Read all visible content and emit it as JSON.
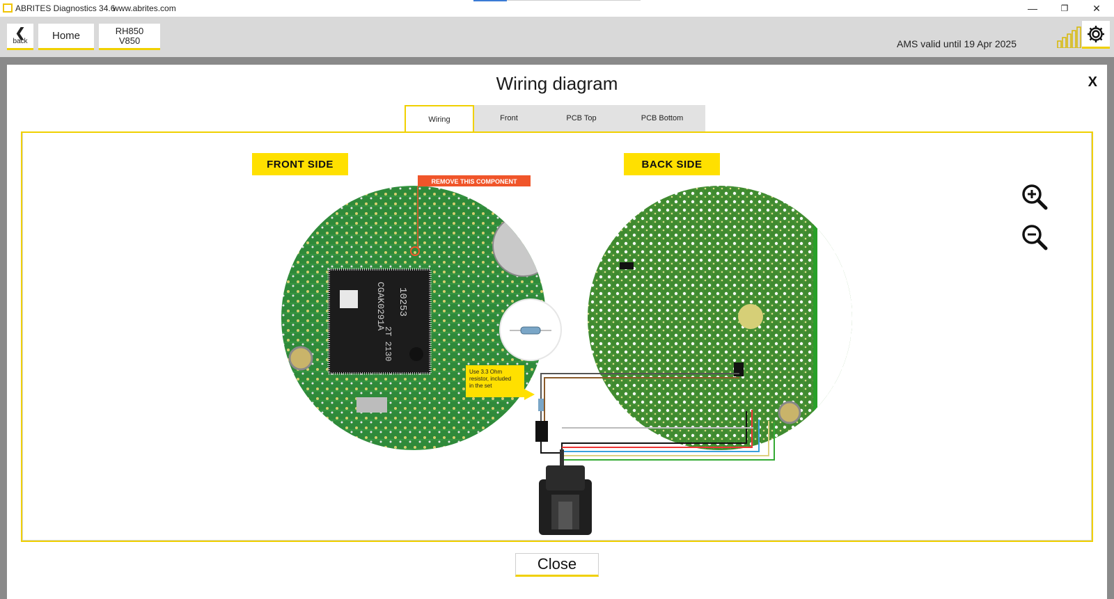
{
  "window": {
    "title": "ABRITES Diagnostics 34.6",
    "url": "www.abrites.com",
    "minimize": "—",
    "restore": "❐",
    "close": "✕"
  },
  "header": {
    "back_arrow": "❮",
    "back_label": "back",
    "home_label": "Home",
    "model_line1": "RH850",
    "model_line2": "V850",
    "ams_text": "AMS valid until 19 Apr 2025",
    "signal_bars": 5,
    "accent_color": "#f0d000"
  },
  "dialog": {
    "title": "Wiring diagram",
    "close_x": "X",
    "tabs": [
      {
        "label": "Wiring",
        "active": true
      },
      {
        "label": "Front",
        "active": false
      },
      {
        "label": "PCB Top",
        "active": false
      },
      {
        "label": "PCB Bottom",
        "active": false
      }
    ],
    "front_side_label": "FRONT SIDE",
    "back_side_label": "BACK SIDE",
    "remove_note": "REMOVE THIS COMPONENT",
    "resistor_note_line1": "Use 3.3 Ohm",
    "resistor_note_line2": "resistor, included",
    "resistor_note_line3": "in the set",
    "chip_text_1": "10253",
    "chip_text_2": "CGAK0291A",
    "chip_text_3": "2T  2130",
    "close_button": "Close"
  }
}
